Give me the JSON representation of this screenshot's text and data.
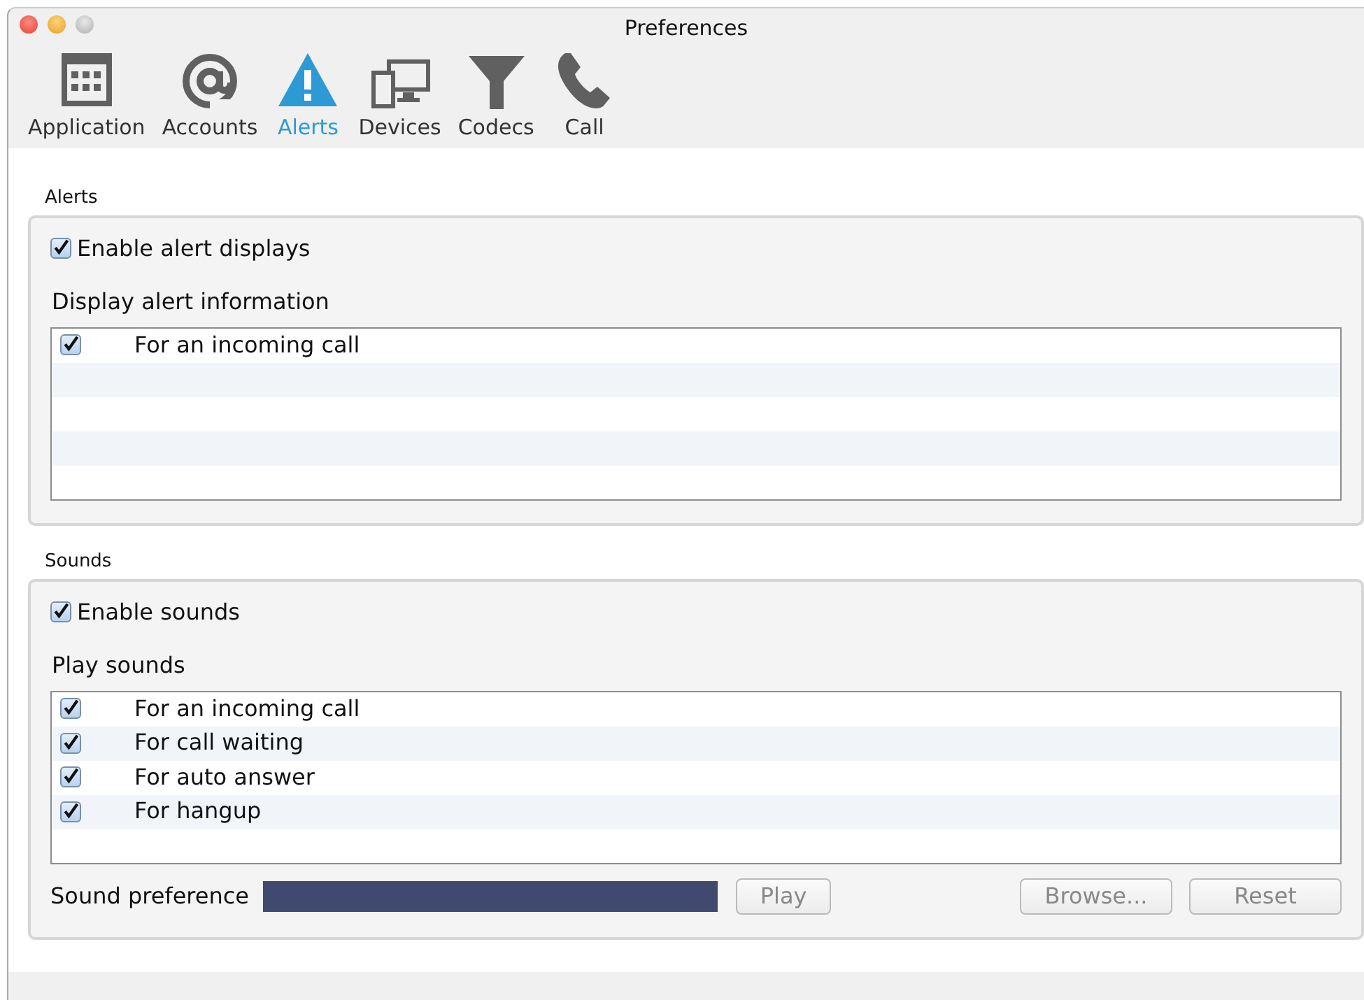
{
  "window": {
    "title": "Preferences"
  },
  "toolbar": [
    {
      "label": "Application",
      "selected": false
    },
    {
      "label": "Accounts",
      "selected": false
    },
    {
      "label": "Alerts",
      "selected": true
    },
    {
      "label": "Devices",
      "selected": false
    },
    {
      "label": "Codecs",
      "selected": false
    },
    {
      "label": "Call",
      "selected": false
    }
  ],
  "sections": [
    {
      "title": "Alerts",
      "enable": {
        "label": "Enable alert displays",
        "checked": true
      },
      "list_label": "Display alert information",
      "items": [
        {
          "label": "For an incoming call",
          "checked": true
        }
      ]
    },
    {
      "title": "Sounds",
      "enable": {
        "label": "Enable sounds",
        "checked": true
      },
      "list_label": "Play sounds",
      "items": [
        {
          "label": "For an incoming call",
          "checked": true
        },
        {
          "label": "For call waiting",
          "checked": true
        },
        {
          "label": "For auto answer",
          "checked": true
        },
        {
          "label": "For hangup",
          "checked": true
        }
      ],
      "footer": {
        "label": "Sound preference",
        "play": {
          "label": "Play",
          "disabled": true
        },
        "buttons": [
          {
            "label": "Browse...",
            "disabled": true
          },
          {
            "label": "Reset",
            "disabled": true
          }
        ]
      }
    }
  ]
}
